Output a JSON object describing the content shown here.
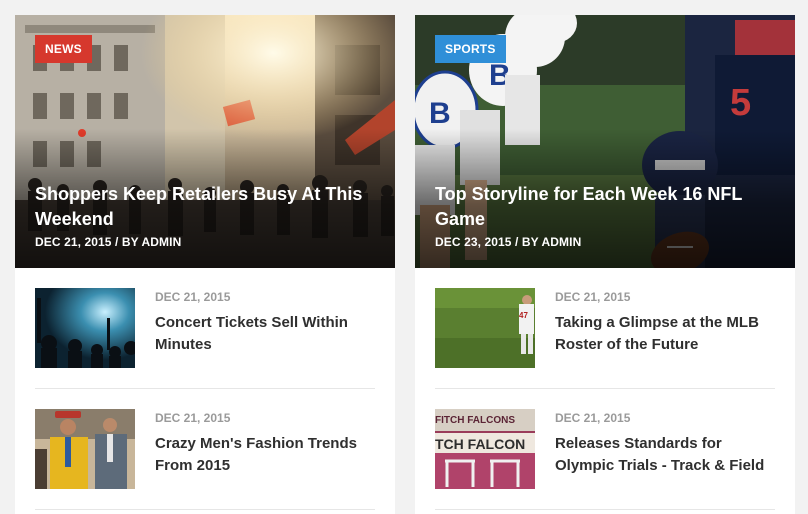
{
  "featured": [
    {
      "category": "NEWS",
      "title": "Shoppers Keep Retailers Busy At This Weekend",
      "meta": "DEC 21, 2015 / BY ADMIN"
    },
    {
      "category": "SPORTS",
      "title": "Top Storyline for Each Week 16 NFL Game",
      "meta": "DEC 23, 2015 / BY ADMIN"
    }
  ],
  "left_list": [
    {
      "date": "DEC 21, 2015",
      "title": "Concert Tickets Sell Within Minutes"
    },
    {
      "date": "DEC 21, 2015",
      "title": "Crazy Men's Fashion Trends From 2015"
    }
  ],
  "right_list": [
    {
      "date": "DEC 21, 2015",
      "title": "Taking a Glimpse at the MLB Roster of the Future"
    },
    {
      "date": "DEC 21, 2015",
      "title": "Releases Standards for Olympic Trials - Track & Field"
    }
  ],
  "thumb_text": {
    "player_number": "47",
    "banner_top": "FITCH FALCONS",
    "banner_bottom": "TCH FALCON"
  },
  "colors": {
    "news_badge": "#d6382d",
    "sports_badge": "#2f8fd8",
    "title_text": "#2f2f2f",
    "date_text": "#9a9a9a"
  }
}
